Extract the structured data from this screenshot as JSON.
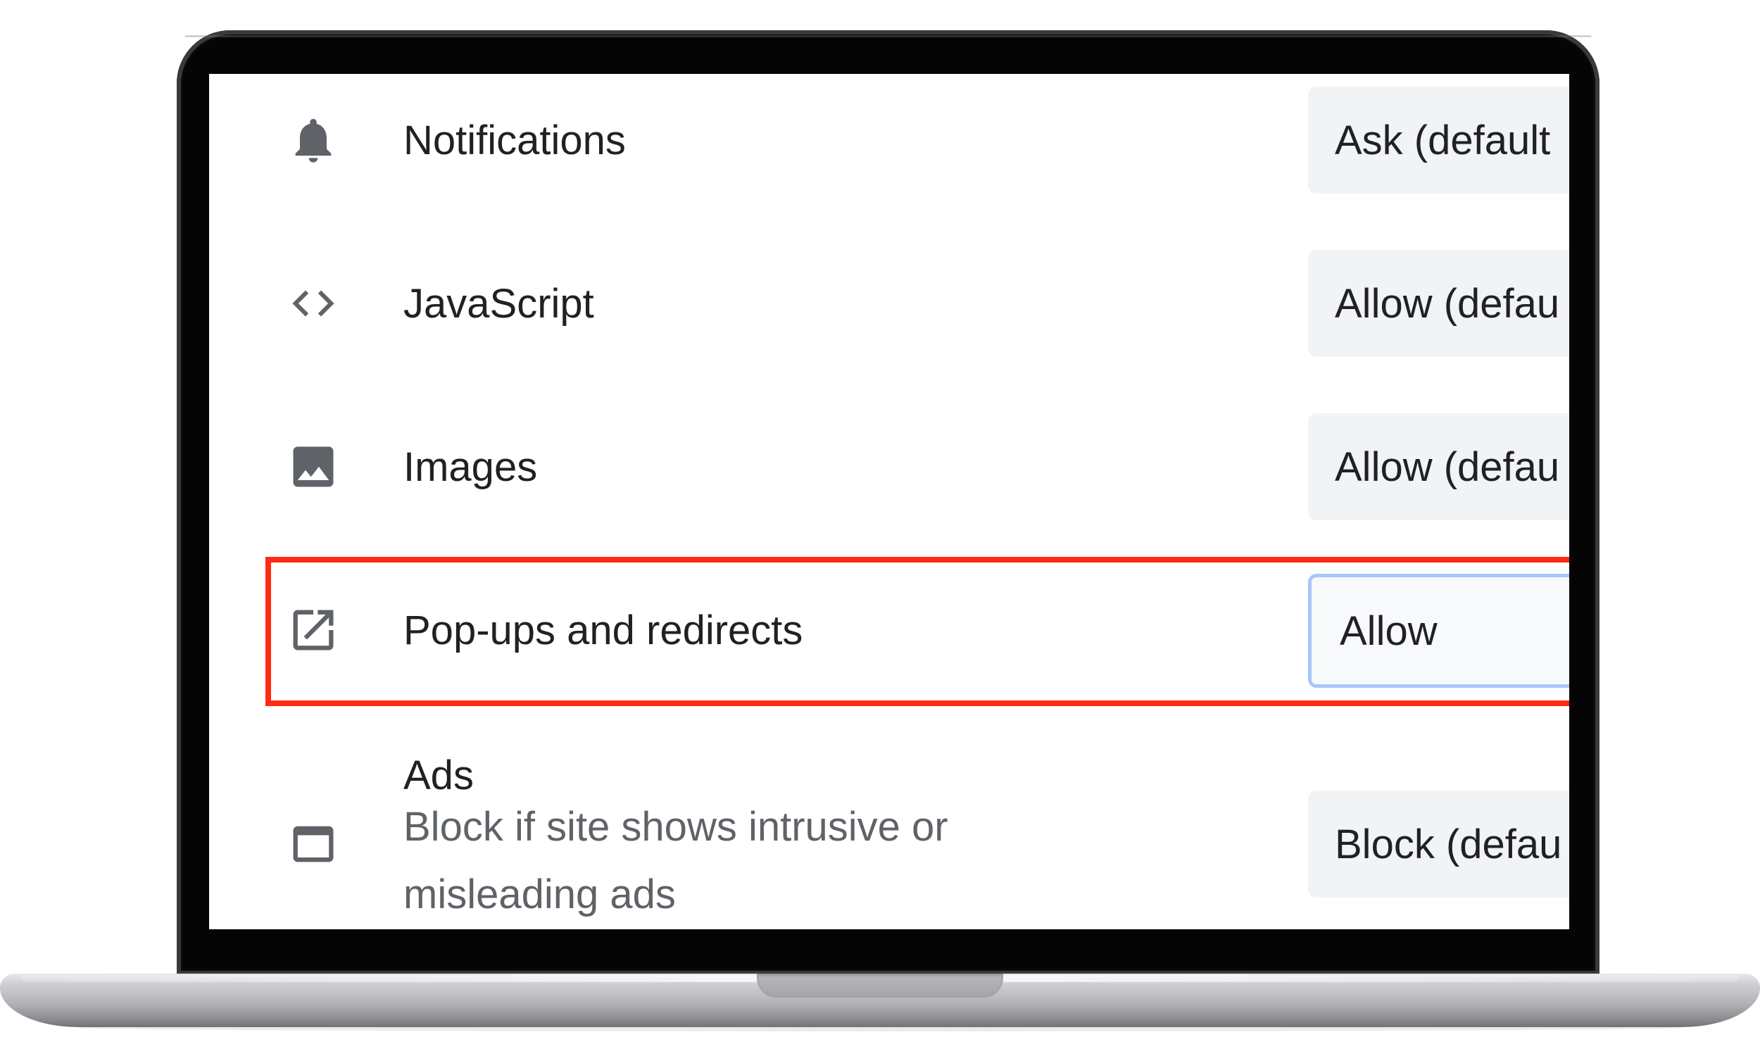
{
  "settings": {
    "rows": [
      {
        "icon": "bell-icon",
        "label": "Notifications",
        "value": "Ask (default"
      },
      {
        "icon": "code-brackets-icon",
        "label": "JavaScript",
        "value": "Allow (defau"
      },
      {
        "icon": "image-icon",
        "label": "Images",
        "value": "Allow (defau"
      },
      {
        "icon": "open-in-new-icon",
        "label": "Pop-ups and redirects",
        "value": "Allow"
      },
      {
        "icon": "browser-window-icon",
        "label": "Ads",
        "description": "Block if site shows intrusive or misleading ads",
        "value": "Block (defau"
      }
    ],
    "highlighted_row": "Pop-ups and redirects"
  },
  "colors": {
    "highlight": "#ff2a12",
    "focus_ring": "#a8c7fa",
    "icon": "#5f6368",
    "text": "#202124",
    "select_bg": "#f1f3f4"
  }
}
